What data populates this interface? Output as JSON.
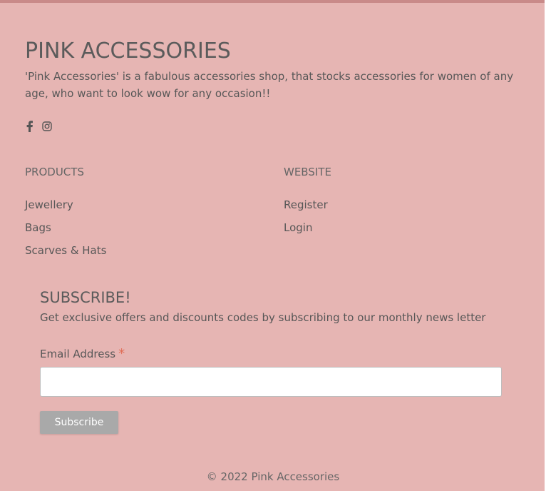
{
  "brand": {
    "title": "PINK ACCESSORIES",
    "description": "'Pink Accessories' is a fabulous accessories shop, that stocks accessories for women of any age, who want to look wow for any occasion!!"
  },
  "social": [
    {
      "icon": "facebook-icon"
    },
    {
      "icon": "instagram-icon"
    }
  ],
  "products": {
    "heading": "PRODUCTS",
    "links": [
      "Jewellery",
      "Bags",
      "Scarves & Hats"
    ]
  },
  "website": {
    "heading": "WEBSITE",
    "links": [
      "Register",
      "Login"
    ]
  },
  "subscribe": {
    "title": "SUBSCRIBE!",
    "description": "Get exclusive offers and discounts codes by subscribing to our monthly news letter",
    "email_label": "Email Address",
    "required_mark": "*",
    "email_value": "",
    "button_label": "Subscribe"
  },
  "copyright": "© 2022 Pink Accessories",
  "colors": {
    "background": "#e6b5b3",
    "top_border": "#c98a89",
    "button": "#a9a9a9",
    "required": "#e06c55"
  }
}
